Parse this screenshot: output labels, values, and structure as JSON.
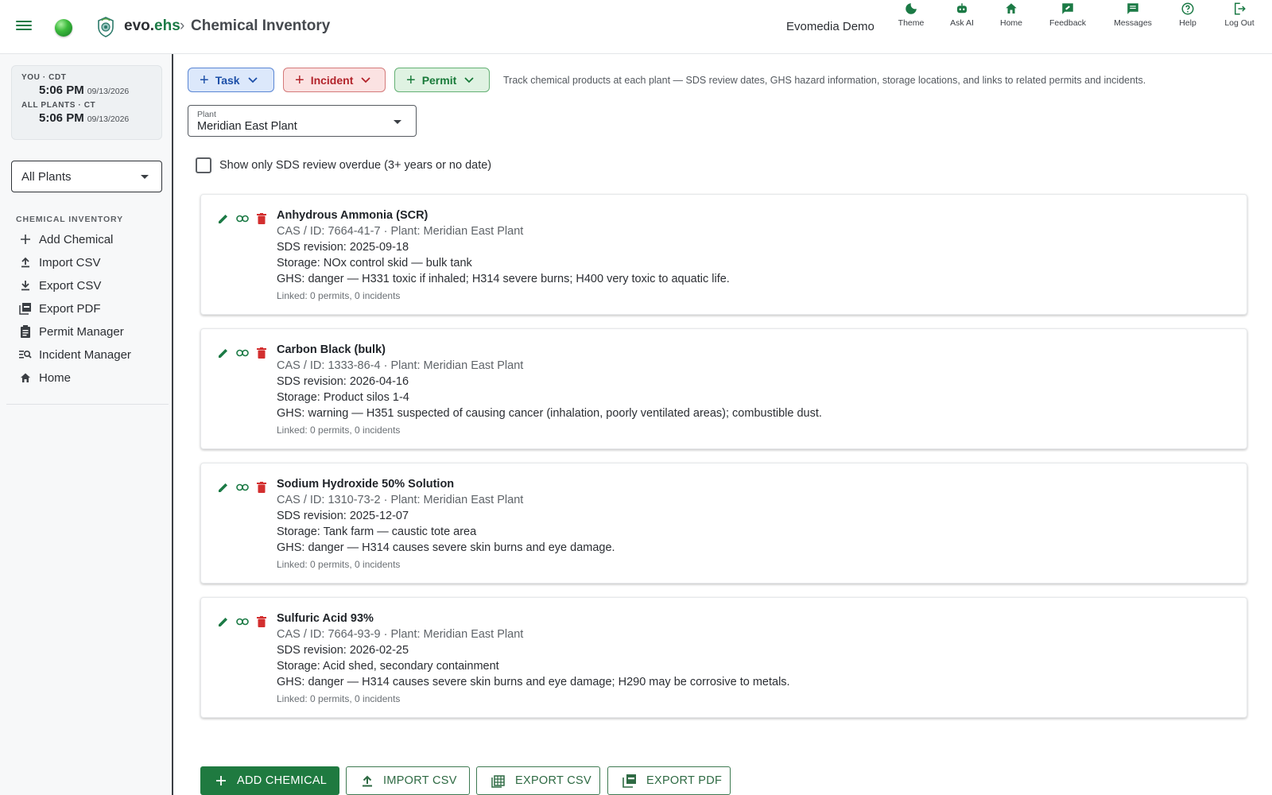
{
  "header": {
    "brand_prefix": "evo.",
    "brand_suffix": "ehs",
    "crumb_separator": "›",
    "page_title": "Chemical Inventory",
    "username": "Evomedia Demo",
    "actions": [
      {
        "label": "Theme",
        "icon": "moon-icon"
      },
      {
        "label": "Ask AI",
        "icon": "robot-icon"
      },
      {
        "label": "Home",
        "icon": "home-icon"
      },
      {
        "label": "Feedback",
        "icon": "feedback-icon"
      },
      {
        "label": "Messages",
        "icon": "message-icon"
      },
      {
        "label": "Help",
        "icon": "help-icon"
      },
      {
        "label": "Log Out",
        "icon": "logout-icon"
      }
    ]
  },
  "sidebar": {
    "clock": {
      "you_label": "YOU · CDT",
      "you_time": "5:06 PM",
      "you_date": "09/13/2026",
      "plants_label": "ALL PLANTS · CT",
      "plants_time": "5:06 PM",
      "plants_date": "09/13/2026"
    },
    "plant_filter": "All Plants",
    "section_title": "CHEMICAL INVENTORY",
    "items": [
      {
        "label": "Add Chemical",
        "icon": "plus-icon"
      },
      {
        "label": "Import CSV",
        "icon": "upload-icon"
      },
      {
        "label": "Export CSV",
        "icon": "download-icon"
      },
      {
        "label": "Export PDF",
        "icon": "pdf-icon"
      },
      {
        "label": "Permit Manager",
        "icon": "clipboard-icon"
      },
      {
        "label": "Incident Manager",
        "icon": "search-list-icon"
      },
      {
        "label": "Home",
        "icon": "home-icon"
      }
    ]
  },
  "toolbar": {
    "task_label": "Task",
    "incident_label": "Incident",
    "permit_label": "Permit",
    "hint": "Track chemical products at each plant — SDS review dates, GHS hazard information, storage locations, and links to related permits and incidents."
  },
  "plant_field": {
    "label": "Plant",
    "value": "Meridian East Plant"
  },
  "overdue_filter": {
    "checked": false,
    "label": "Show only SDS review overdue (3+ years or no date)"
  },
  "chemicals": [
    {
      "name": "Anhydrous Ammonia (SCR)",
      "cas_line": "CAS / ID: 7664-41-7 · Plant: Meridian East Plant",
      "sds_line": "SDS revision: 2025-09-18",
      "storage_line": "Storage: NOx control skid — bulk tank",
      "ghs_line": "GHS: danger — H331 toxic if inhaled; H314 severe burns; H400 very toxic to aquatic life.",
      "linked_line": "Linked: 0 permits, 0 incidents"
    },
    {
      "name": "Carbon Black (bulk)",
      "cas_line": "CAS / ID: 1333-86-4 · Plant: Meridian East Plant",
      "sds_line": "SDS revision: 2026-04-16",
      "storage_line": "Storage: Product silos 1-4",
      "ghs_line": "GHS: warning — H351 suspected of causing cancer (inhalation, poorly ventilated areas); combustible dust.",
      "linked_line": "Linked: 0 permits, 0 incidents"
    },
    {
      "name": "Sodium Hydroxide 50% Solution",
      "cas_line": "CAS / ID: 1310-73-2 · Plant: Meridian East Plant",
      "sds_line": "SDS revision: 2025-12-07",
      "storage_line": "Storage: Tank farm — caustic tote area",
      "ghs_line": "GHS: danger — H314 causes severe skin burns and eye damage.",
      "linked_line": "Linked: 0 permits, 0 incidents"
    },
    {
      "name": "Sulfuric Acid 93%",
      "cas_line": "CAS / ID: 7664-93-9 · Plant: Meridian East Plant",
      "sds_line": "SDS revision: 2026-02-25",
      "storage_line": "Storage: Acid shed, secondary containment",
      "ghs_line": "GHS: danger — H314 causes severe skin burns and eye damage; H290 may be corrosive to metals.",
      "linked_line": "Linked: 0 permits, 0 incidents"
    }
  ],
  "bottom_actions": {
    "add_label": "ADD CHEMICAL",
    "import_label": "IMPORT CSV",
    "export_csv_label": "EXPORT CSV",
    "export_pdf_label": "EXPORT PDF"
  },
  "colors": {
    "brand_green": "#1b7a45",
    "danger_red": "#d32f2f",
    "task_blue": "#1c4fa8"
  }
}
